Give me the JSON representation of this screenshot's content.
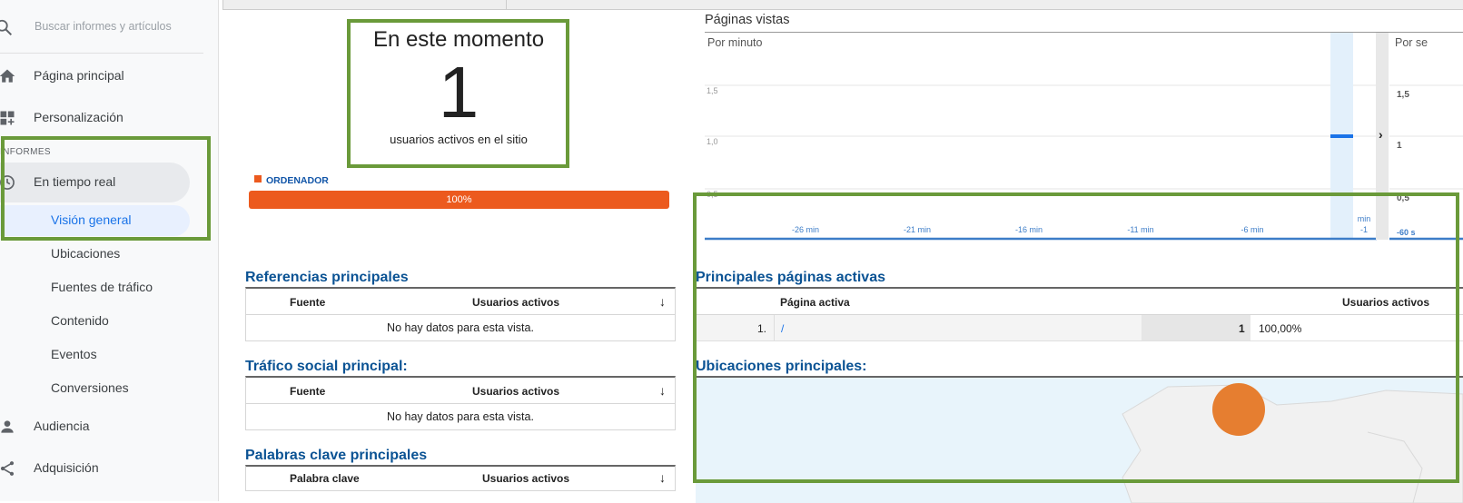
{
  "sidebar": {
    "search_placeholder": "Buscar informes y artículos",
    "nav": {
      "home": "Página principal",
      "customization": "Personalización"
    },
    "section_label": "INFORMES",
    "realtime": "En tiempo real",
    "realtime_items": [
      "Visión general",
      "Ubicaciones",
      "Fuentes de tráfico",
      "Contenido",
      "Eventos",
      "Conversiones"
    ],
    "audience": "Audiencia",
    "acquisition": "Adquisición"
  },
  "right_now": {
    "title": "En este momento",
    "count": "1",
    "subtitle": "usuarios activos en el sitio",
    "device_label": "ORDENADOR",
    "device_percent": "100%",
    "device_fraction": 1.0
  },
  "pageviews": {
    "title": "Páginas vistas",
    "per_minute": "Por minuto",
    "per_second": "Por se",
    "arrow": "›"
  },
  "chart_data": [
    {
      "type": "bar",
      "title": "Por minuto",
      "y_ticks": [
        "1,5",
        "1,0",
        "0,5"
      ],
      "x_ticks": [
        "-26 min",
        "-21 min",
        "-16 min",
        "-11 min",
        "-6 min",
        "-1"
      ],
      "x_unit_label": "min",
      "categories": [
        "-1"
      ],
      "values": [
        1
      ],
      "ylim": [
        0,
        1.5
      ],
      "bar_color": "#1a73e8"
    },
    {
      "type": "bar",
      "title": "Por se",
      "y_ticks": [
        "1,5",
        "1",
        "0,5"
      ],
      "x_ticks": [
        "-60 s"
      ],
      "ylim": [
        0,
        1.5
      ]
    }
  ],
  "referrals": {
    "title": "Referencias principales",
    "col_source": "Fuente",
    "col_users": "Usuarios activos",
    "sort_icon": "↓",
    "empty": "No hay datos para esta vista."
  },
  "social": {
    "title": "Tráfico social principal:",
    "col_source": "Fuente",
    "col_users": "Usuarios activos",
    "sort_icon": "↓",
    "empty": "No hay datos para esta vista."
  },
  "keywords": {
    "title": "Palabras clave principales",
    "col_keyword": "Palabra clave",
    "col_users": "Usuarios activos",
    "sort_icon": "↓"
  },
  "active_pages": {
    "title": "Principales páginas activas",
    "col_page": "Página activa",
    "col_users": "Usuarios activos",
    "rows": [
      {
        "index": "1.",
        "page": "/",
        "users": "1",
        "percent": "100,00%"
      }
    ]
  },
  "locations": {
    "title": "Ubicaciones principales:"
  }
}
